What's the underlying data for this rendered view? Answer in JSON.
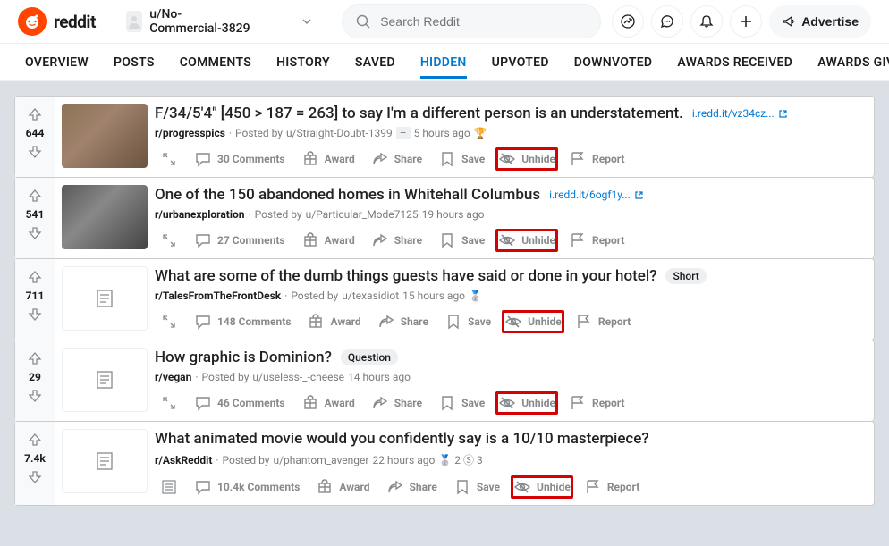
{
  "header": {
    "brand": "reddit",
    "username": "u/No-Commercial-3829",
    "search_placeholder": "Search Reddit",
    "advertise": "Advertise"
  },
  "tabs": {
    "items": [
      "OVERVIEW",
      "POSTS",
      "COMMENTS",
      "HISTORY",
      "SAVED",
      "HIDDEN",
      "UPVOTED",
      "DOWNVOTED",
      "AWARDS RECEIVED",
      "AWARDS GIVEN"
    ],
    "activeIndex": 5
  },
  "action_labels": {
    "award": "Award",
    "share": "Share",
    "save": "Save",
    "unhide": "Unhide",
    "report": "Report"
  },
  "posts": [
    {
      "score": "644",
      "thumb": "photo",
      "title": "F/34/5'4\" [450 > 187 = 263] to say I'm a different person is an understatement.",
      "ext": "i.redd.it/vz34cz...",
      "subreddit": "r/progresspics",
      "posted_by": "u/Straight-Doubt-1399",
      "age": "5 hours ago",
      "nsfw_dash": true,
      "award_emoji": true,
      "comments": "30 Comments",
      "show_expand": true
    },
    {
      "score": "541",
      "thumb": "photo2",
      "title": "One of the 150 abandoned homes in Whitehall Columbus",
      "ext": "i.redd.it/6ogf1y...",
      "subreddit": "r/urbanexploration",
      "posted_by": "u/Particular_Mode7125",
      "age": "19 hours ago",
      "comments": "27 Comments",
      "show_expand": true
    },
    {
      "score": "711",
      "thumb": "text",
      "title": "What are some of the dumb things guests have said or done in your hotel?",
      "flair": "Short",
      "subreddit": "r/TalesFromTheFrontDesk",
      "posted_by": "u/texasidiot",
      "age": "15 hours ago",
      "meta_emoji": true,
      "comments": "148 Comments",
      "show_expand": true
    },
    {
      "score": "29",
      "thumb": "text",
      "title": "How graphic is Dominion?",
      "flair": "Question",
      "subreddit": "r/vegan",
      "posted_by": "u/useless-_-cheese",
      "age": "14 hours ago",
      "comments": "46 Comments",
      "show_expand": true
    },
    {
      "score": "7.4k",
      "thumb": "text",
      "title": "What animated movie would you confidently say is a 10/10 masterpiece?",
      "subreddit": "r/AskReddit",
      "posted_by": "u/phantom_avenger",
      "age": "22 hours ago",
      "award_badges": "2 Ⓢ 3",
      "comments": "10.4k Comments",
      "show_expand": false,
      "expand_box_only": true
    }
  ]
}
